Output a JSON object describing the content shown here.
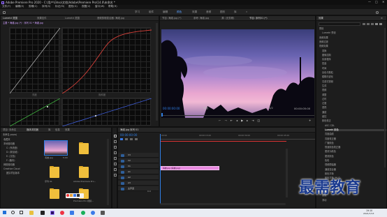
{
  "window": {
    "title": "Adobe Premiere Pro 2020 - C:\\用户\\Ghso\\文档\\Adobe\\Premiere Pro\\14.0\\未命名 *",
    "minimize": "—",
    "maximize": "□",
    "close": "✕"
  },
  "menu": [
    "文件(F)",
    "编辑(E)",
    "剪辑(C)",
    "序列(S)",
    "标记(M)",
    "图形(G)",
    "视图(V)",
    "窗口(W)",
    "帮助(H)"
  ],
  "workspaces": {
    "items": [
      "学习",
      "组件",
      "编辑",
      "颜色",
      "效果",
      "音频",
      "图形",
      "库"
    ],
    "active_index": 3,
    "more": "»"
  },
  "scopes": {
    "tabs": [
      "Lumetri 范围",
      "效果控件",
      "Lumetri 范围",
      "音频剪辑混合器: 海滩.jpg"
    ],
    "header_left": "主要 * 海滩.jpg (*) · 序列 01 * 海滩.jpg",
    "curve_label_1": "亮度",
    "curve_label_2": "饱和度"
  },
  "program_monitor": {
    "tabs": [
      "节目: 海滩.jpg (*)",
      "参考: 海滩.jpg",
      "源: (无剪辑)",
      "节目: 序列01 (*)"
    ],
    "timecode_left": "00:00:00:00",
    "fit": "适合",
    "quality": "1/2",
    "timecode_right": "00:00:05:00"
  },
  "project": {
    "tabs": [
      "项目: 未命名",
      "媒体浏览器",
      "库",
      "信息",
      "效果"
    ],
    "header": "未命名.prproj",
    "tree": [
      "收藏夹",
      "本地驱动器",
      "C: (系统盘)",
      "D: (新加坡)",
      "E: (文档)",
      "F: (备份)",
      "网络驱动器",
      "Creative Cloud",
      "团队项目版本"
    ],
    "items": [
      {
        "name": "海滩.jpg",
        "duration": "5:00"
      },
      {
        "name": "",
        "duration": ""
      },
      {
        "name": "序列 01",
        "duration": "5:00"
      },
      {
        "name": "Adobe Premiere Pro...",
        "duration": ""
      },
      {
        "name": "Premiere Pro 视频...",
        "duration": ""
      }
    ]
  },
  "timeline": {
    "tab": "海滩.jpg 序列 01",
    "timecode": "00:00:00:00",
    "ruler": [
      "00:00",
      "00:00:15:00",
      "00:00:30:00",
      "00:00:45:00"
    ],
    "tracks": [
      "V3",
      "V2",
      "V1",
      "A1",
      "A2",
      "A3",
      "主声道"
    ],
    "master_value": "0.0",
    "clip_label": "海滩.jpg [海滩.jpg]"
  },
  "effects": {
    "tab": "效果",
    "tab2": "≡",
    "items": [
      "预设",
      "Lumetri 预设",
      "音频效果",
      "音频过渡",
      "视频效果",
      "变换",
      "图像控制",
      "实用程序",
      "扭曲",
      "时间",
      "杂色与颗粒",
      "模糊与锐化",
      "沉浸式视频",
      "生成",
      "视频",
      "调整",
      "过时",
      "过渡",
      "透视",
      "通道",
      "键控",
      "颜色校正",
      "ASC CDL",
      "Lumetri 颜色",
      "亮度曲线",
      "亮度校正器",
      "广播颜色",
      "快速颜色校正器",
      "更改为颜色",
      "更改颜色",
      "色彩",
      "视频限幅器",
      "通道混合器",
      "颜色平衡",
      "颜色平衡 (HLS)",
      "风格化",
      "视频过渡",
      "溶解",
      "擦除",
      "滑动"
    ],
    "highlight_index": 23
  },
  "watermark": "最需教育",
  "taskbar": {
    "time": "19:10",
    "date": "2021/7/13"
  },
  "colors": {
    "accent": "#2f7fe6",
    "clip": "#e98ae0",
    "playhead": "#d33"
  }
}
